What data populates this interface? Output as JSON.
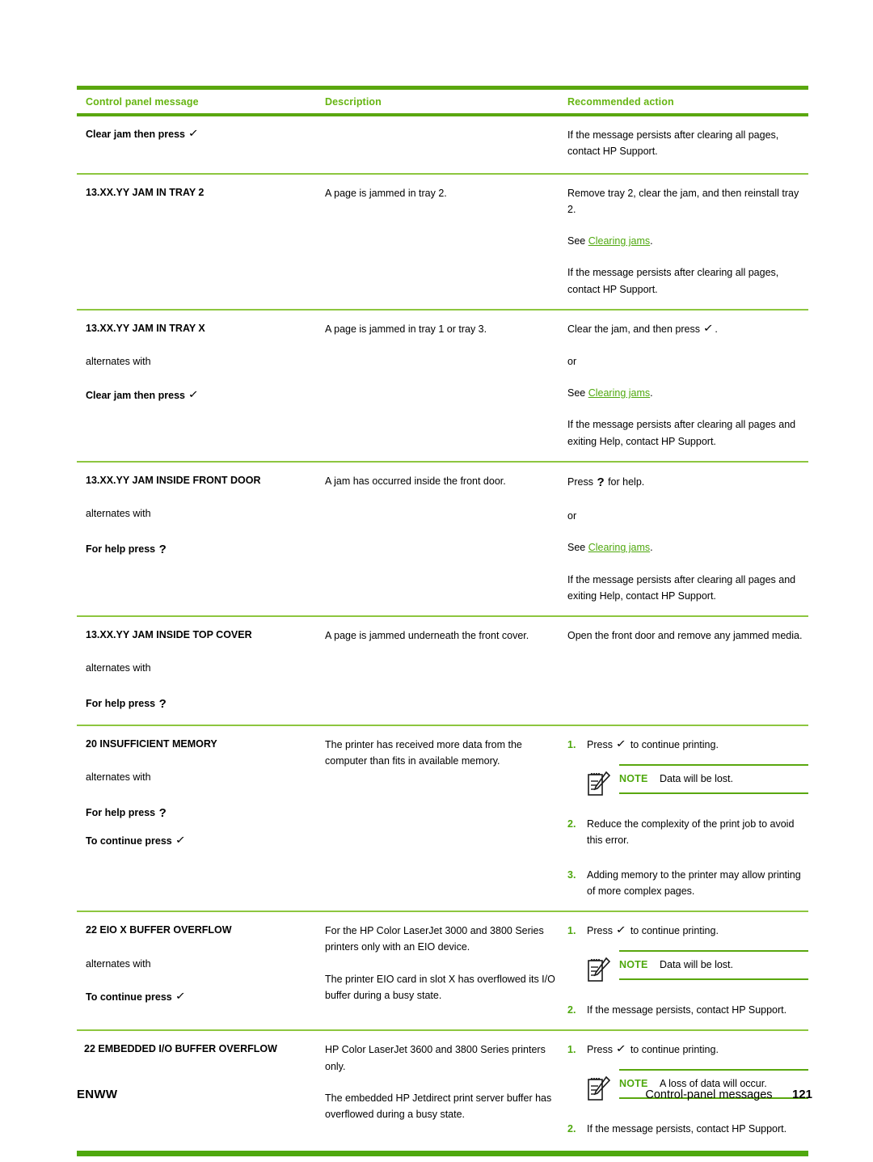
{
  "table": {
    "headers": [
      "Control panel message",
      "Description",
      "Recommended action"
    ],
    "rows": [
      {
        "message": "Clear jam then press ",
        "message_glyph": "check",
        "alternates_label": "",
        "message2": "",
        "message2_glyph": "",
        "description": [],
        "actions": [
          "If the message persists after clearing all pages, contact HP Support."
        ]
      },
      {
        "message": "13.XX.YY JAM IN TRAY 2",
        "message_glyph": "",
        "alternates_label": "",
        "message2": "",
        "message2_glyph": "",
        "description": [
          "A page is jammed in tray 2."
        ],
        "actions": [
          "Remove tray 2, clear the jam, and then reinstall tray 2.",
          "See Clearing jams.",
          "If the message persists after clearing all pages, contact HP Support."
        ],
        "action_see_prefix": "See ",
        "action_link": "Clearing jams",
        "action_see_suffix": "."
      },
      {
        "message": "13.XX.YY JAM IN TRAY X",
        "message_glyph": "",
        "alternates_label": "alternates with",
        "message2": "Clear jam then press ",
        "message2_glyph": "check",
        "description": [
          "A page is jammed in tray 1 or tray 3."
        ],
        "actions": [
          "Clear the jam, and then press ",
          "or",
          "See Clearing jams.",
          "If the message persists after clearing all pages and exiting Help, contact HP Support."
        ]
      },
      {
        "message": "13.XX.YY JAM INSIDE FRONT DOOR",
        "message_glyph": "",
        "alternates_label": "alternates with",
        "message2": "For help press ",
        "message2_glyph": "question",
        "description": [
          "A jam has occurred inside the front door."
        ],
        "actions": [
          "Press ? for help.",
          "or",
          "See Clearing jams.",
          "If the message persists after clearing all pages and exiting Help, contact HP Support."
        ]
      },
      {
        "message": "13.XX.YY JAM INSIDE TOP COVER",
        "message_glyph": "",
        "alternates_label": "alternates with",
        "message2": "For help press ",
        "message2_glyph": "question",
        "description": [
          "A page is jammed underneath the front cover."
        ],
        "actions": [
          "Open the front door and remove any jammed media."
        ]
      },
      {
        "message": "20 INSUFFICIENT MEMORY",
        "message_glyph": "",
        "alternates_label": "alternates with",
        "message2": "For help press ",
        "message2_glyph": "question",
        "message3": "To continue press ",
        "message3_glyph": "check",
        "description": [
          "The printer has received more data from the computer than fits in available memory."
        ],
        "steps": [
          {
            "num": "1.",
            "text_before": "Press ",
            "glyph": "check",
            "text_after": " to continue printing.",
            "note": {
              "label": "NOTE",
              "text": "Data will be lost."
            }
          },
          {
            "num": "2.",
            "text_before": "Reduce the complexity of the print job to avoid this error.",
            "glyph": "",
            "text_after": ""
          },
          {
            "num": "3.",
            "text_before": "Adding memory to the printer may allow printing of more complex pages.",
            "glyph": "",
            "text_after": ""
          }
        ]
      },
      {
        "message": "22 EIO X BUFFER OVERFLOW",
        "message_glyph": "",
        "alternates_label": "alternates with",
        "message2": "To continue press ",
        "message2_glyph": "check",
        "description": [
          "For the HP Color LaserJet 3000 and 3800 Series printers only with an EIO device.",
          "The printer EIO card in slot X has overflowed its I/O buffer during a busy state."
        ],
        "steps": [
          {
            "num": "1.",
            "text_before": "Press ",
            "glyph": "check",
            "text_after": " to continue printing.",
            "note": {
              "label": "NOTE",
              "text": "Data will be lost."
            }
          },
          {
            "num": "2.",
            "text_before": "If the message persists, contact HP Support.",
            "glyph": "",
            "text_after": ""
          }
        ]
      },
      {
        "message": "22 EMBEDDED I/O BUFFER OVERFLOW",
        "message_glyph": "",
        "alternates_label": "",
        "message2": "",
        "message2_glyph": "",
        "description": [
          "HP Color LaserJet 3600 and 3800 Series printers only.",
          "The embedded HP Jetdirect print server buffer has overflowed during a busy state."
        ],
        "steps": [
          {
            "num": "1.",
            "text_before": "Press ",
            "glyph": "check",
            "text_after": " to continue printing.",
            "note": {
              "label": "NOTE",
              "text": "A loss of data will occur."
            }
          },
          {
            "num": "2.",
            "text_before": "If the message persists, contact HP Support.",
            "glyph": "",
            "text_after": ""
          }
        ]
      }
    ]
  },
  "row1": {
    "message": "Clear jam then press",
    "action1": "If the message persists after clearing all pages, contact HP Support."
  },
  "row2": {
    "message": "13.XX.YY JAM IN TRAY 2",
    "description": "A page is jammed in tray 2.",
    "action1": "Remove tray 2, clear the jam, and then reinstall tray 2.",
    "see_prefix": "See ",
    "link": "Clearing jams",
    "see_suffix": ".",
    "action3": "If the message persists after clearing all pages, contact HP Support."
  },
  "row3": {
    "message": "13.XX.YY JAM IN TRAY X",
    "alternates": "alternates with",
    "message2": "Clear jam then press",
    "description": "A page is jammed in tray 1 or tray 3.",
    "action1_pre": "Clear the jam, and then press",
    "action1_post": ".",
    "action2": "or",
    "see_prefix": "See ",
    "link": "Clearing jams",
    "see_suffix": ".",
    "action4": "If the message persists after clearing all pages and exiting Help, contact HP Support."
  },
  "row4": {
    "message": "13.XX.YY JAM INSIDE FRONT DOOR",
    "alternates": "alternates with",
    "message2": "For help press",
    "description": "A jam has occurred inside the front door.",
    "action1_pre": "Press",
    "action1_post": " for help.",
    "action2": "or",
    "see_prefix": "See ",
    "link": "Clearing jams",
    "see_suffix": ".",
    "action4": "If the message persists after clearing all pages and exiting Help, contact HP Support."
  },
  "row5": {
    "message": "13.XX.YY JAM INSIDE TOP COVER",
    "alternates": "alternates with",
    "message2": "For help press",
    "description": "A page is jammed underneath the front cover.",
    "action1": "Open the front door and remove any jammed media."
  },
  "row6": {
    "message": "20 INSUFFICIENT MEMORY",
    "alternates": "alternates with",
    "message2": "For help press",
    "message3": "To continue press",
    "description": "The printer has received more data from the computer than fits in available memory.",
    "n1": "1.",
    "s1_pre": "Press",
    "s1_post": " to continue printing.",
    "note_label": "NOTE",
    "note_text": "Data will be lost.",
    "n2": "2.",
    "s2": "Reduce the complexity of the print job to avoid this error.",
    "n3": "3.",
    "s3": "Adding memory to the printer may allow printing of more complex pages."
  },
  "row7": {
    "message": "22 EIO X BUFFER OVERFLOW",
    "alternates": "alternates with",
    "message2": "To continue press",
    "description1": "For the HP Color LaserJet 3000 and 3800 Series printers only with an EIO device.",
    "description2": "The printer EIO card in slot X has overflowed its I/O buffer during a busy state.",
    "n1": "1.",
    "s1_pre": "Press",
    "s1_post": " to continue printing.",
    "note_label": "NOTE",
    "note_text": "Data will be lost.",
    "n2": "2.",
    "s2": "If the message persists, contact HP Support."
  },
  "row8": {
    "message": "22 EMBEDDED I/O BUFFER OVERFLOW",
    "description1": "HP Color LaserJet 3600 and 3800 Series printers only.",
    "description2": "The embedded HP Jetdirect print server buffer has overflowed during a busy state.",
    "n1": "1.",
    "s1_pre": "Press",
    "s1_post": " to continue printing.",
    "note_label": "NOTE",
    "note_text": "A loss of data will occur.",
    "n2": "2.",
    "s2": "If the message persists, contact HP Support."
  },
  "headers": {
    "h1": "Control panel message",
    "h2": "Description",
    "h3": "Recommended action"
  },
  "footer": {
    "left": "ENWW",
    "section": "Control-panel messages",
    "page": "121"
  },
  "colors": {
    "green_rule": "#5aa70f",
    "green_text": "#66b512",
    "green_link": "#4fa80e",
    "green_light_rule": "#8dc63f"
  },
  "glyphs": {
    "check": "✓",
    "question": "?"
  }
}
